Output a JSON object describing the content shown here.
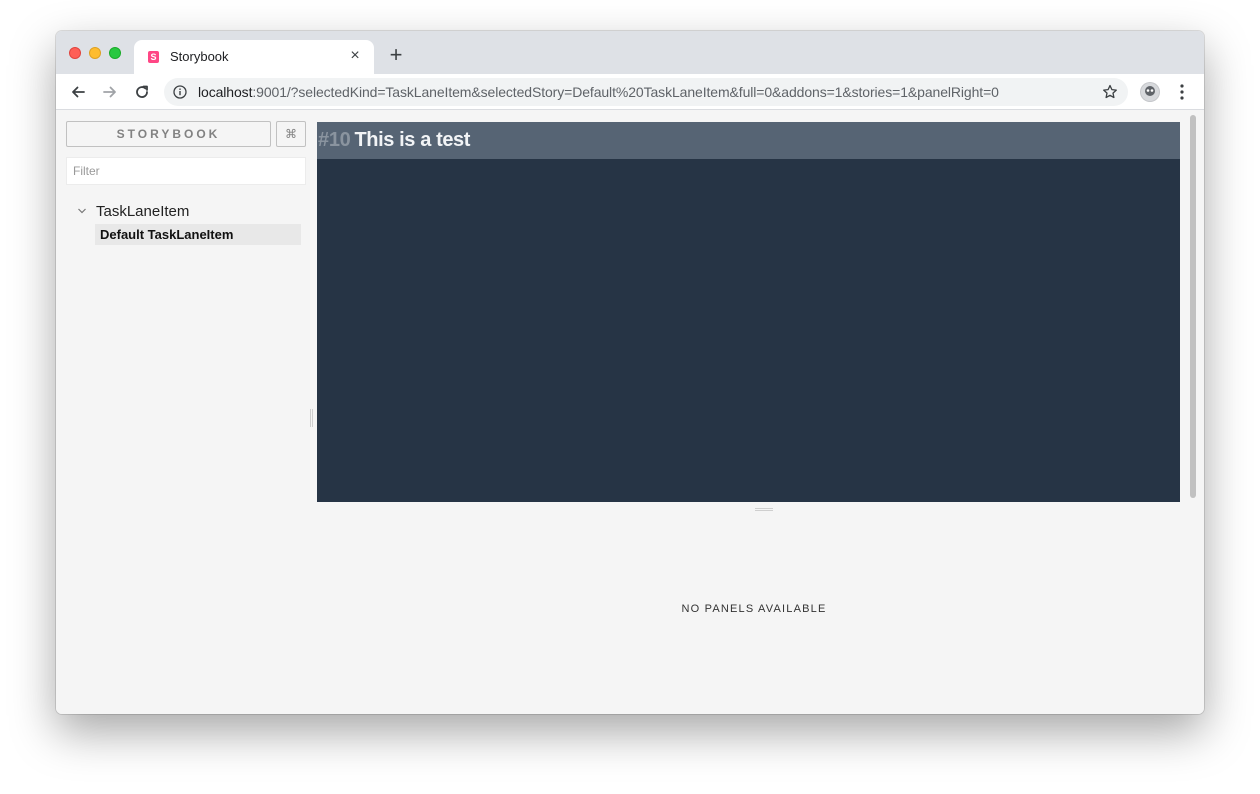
{
  "browser": {
    "tab_title": "Storybook",
    "tab_favicon_letter": "S",
    "tab_close": "×",
    "new_tab": "+",
    "url_host": "localhost",
    "url_rest": ":9001/?selectedKind=TaskLaneItem&selectedStory=Default%20TaskLaneItem&full=0&addons=1&stories=1&panelRight=0"
  },
  "sidebar": {
    "brand_label": "STORYBOOK",
    "shortcut_label": "⌘",
    "filter_placeholder": "Filter",
    "filter_value": "",
    "kinds": [
      {
        "label": "TaskLaneItem",
        "expanded": true,
        "stories": [
          {
            "label": "Default TaskLaneItem",
            "selected": true
          }
        ]
      }
    ]
  },
  "preview": {
    "task_number": "#10",
    "task_title": "This is a test"
  },
  "addons_panel": {
    "message": "NO PANELS AVAILABLE"
  },
  "colors": {
    "preview_bg": "#263445",
    "preview_header_bg": "#566474",
    "storybook_brand": "#ff4785",
    "app_bg": "#f5f5f5"
  }
}
